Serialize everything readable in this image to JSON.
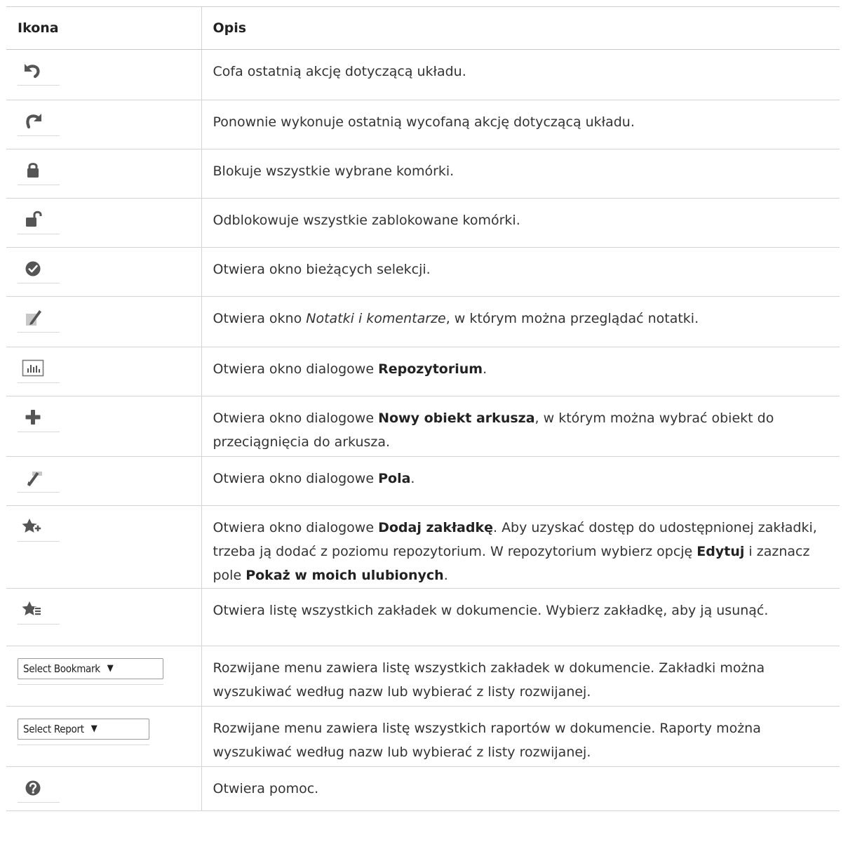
{
  "table": {
    "headers": {
      "icon": "Ikona",
      "description": "Opis"
    },
    "rows": [
      {
        "icon": "undo-icon",
        "description": [
          {
            "text": "Cofa ostatnią akcję dotyczącą układu."
          }
        ]
      },
      {
        "icon": "redo-icon",
        "description": [
          {
            "text": "Ponownie wykonuje ostatnią wycofaną akcję dotyczącą układu."
          }
        ]
      },
      {
        "icon": "lock-icon",
        "description": [
          {
            "text": "Blokuje wszystkie wybrane komórki."
          }
        ]
      },
      {
        "icon": "unlock-icon",
        "description": [
          {
            "text": "Odblokowuje wszystkie zablokowane komórki."
          }
        ]
      },
      {
        "icon": "current-selections-icon",
        "description": [
          {
            "text": "Otwiera okno bieżących selekcji."
          }
        ]
      },
      {
        "icon": "notes-icon",
        "description": [
          {
            "text": "Otwiera okno "
          },
          {
            "text": "Notatki i komentarze",
            "style": "italic"
          },
          {
            "text": ", w którym można przeglądać notatki."
          }
        ]
      },
      {
        "icon": "repository-icon",
        "description": [
          {
            "text": "Otwiera okno dialogowe "
          },
          {
            "text": "Repozytorium",
            "style": "bold"
          },
          {
            "text": "."
          }
        ]
      },
      {
        "icon": "plus-icon",
        "description": [
          {
            "text": "Otwiera okno dialogowe "
          },
          {
            "text": "Nowy obiekt arkusza",
            "style": "bold"
          },
          {
            "text": ", w którym można wybrać obiekt do przeciągnięcia do arkusza."
          }
        ]
      },
      {
        "icon": "fields-icon",
        "description": [
          {
            "text": "Otwiera okno dialogowe "
          },
          {
            "text": "Pola",
            "style": "bold"
          },
          {
            "text": "."
          }
        ]
      },
      {
        "icon": "add-bookmark-icon",
        "description": [
          {
            "text": "Otwiera okno dialogowe "
          },
          {
            "text": "Dodaj zakładkę",
            "style": "bold"
          },
          {
            "text": ". Aby uzyskać dostęp do udostępnionej zakładki, trzeba ją dodać z poziomu repozytorium. W repozytorium wybierz opcję "
          },
          {
            "text": "Edytuj",
            "style": "bold"
          },
          {
            "text": " i zaznacz pole "
          },
          {
            "text": "Pokaż w moich ulubionych",
            "style": "bold"
          },
          {
            "text": "."
          }
        ]
      },
      {
        "icon": "remove-bookmark-icon",
        "description": [
          {
            "text": "Otwiera listę wszystkich zakładek w dokumencie. Wybierz zakładkę, aby ją usunąć."
          }
        ]
      },
      {
        "icon": "select-dropdown",
        "select_label": "Select Bookmark",
        "select_width": 220,
        "description": [
          {
            "text": "Rozwijane menu zawiera listę wszystkich zakładek w dokumencie. Zakładki można wyszukiwać według nazw lub wybierać z listy rozwijanej."
          }
        ]
      },
      {
        "icon": "select-dropdown",
        "select_label": "Select Report",
        "select_width": 200,
        "description": [
          {
            "text": "Rozwijane menu zawiera listę wszystkich raportów w dokumencie. Raporty można wyszukiwać według nazw lub wybierać z listy rozwijanej."
          }
        ]
      },
      {
        "icon": "help-icon",
        "description": [
          {
            "text": "Otwiera pomoc."
          }
        ]
      }
    ]
  },
  "colors": {
    "icon_gray": "#555555",
    "text": "#333333",
    "border": "#d3d3d3"
  }
}
